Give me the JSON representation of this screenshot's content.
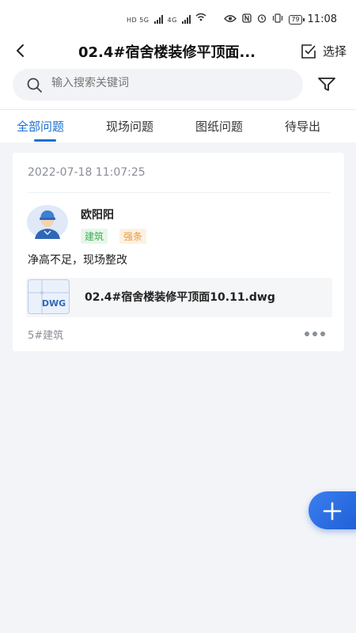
{
  "status_bar": {
    "network_left": "HD 5G",
    "network_right": "4G",
    "battery": "79",
    "time": "11:08"
  },
  "header": {
    "title": "02.4#宿舍楼装修平顶面...",
    "select_label": "选择"
  },
  "search": {
    "placeholder": "输入搜索关键词"
  },
  "tabs": [
    {
      "label": "全部问题",
      "active": true
    },
    {
      "label": "现场问题",
      "active": false
    },
    {
      "label": "图纸问题",
      "active": false
    },
    {
      "label": "待导出",
      "active": false
    }
  ],
  "colors": {
    "accent": "#1a6fd1",
    "background": "#f2f4f8",
    "tag_green": "#3fae54",
    "tag_orange": "#e89a3c"
  },
  "card": {
    "date": "2022-07-18 11:07:25",
    "author": "欧阳阳",
    "tags": [
      "建筑",
      "强条"
    ],
    "description": "净高不足，现场整改",
    "file_type": "DWG",
    "file_name": "02.4#宿舍楼装修平顶面10.11.dwg",
    "location": "5#建筑"
  }
}
